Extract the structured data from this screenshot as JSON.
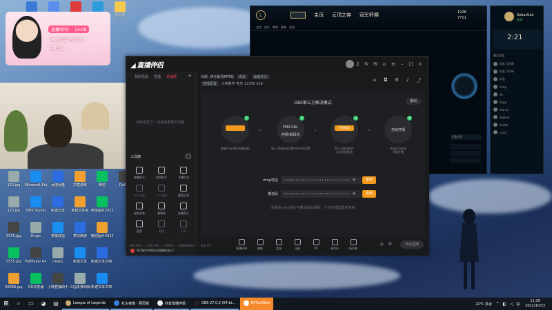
{
  "desktop": {
    "icons_top": [
      {
        "label": "Debut Video"
      },
      {
        "label": "iPhone Backup"
      },
      {
        "label": "网易云音乐"
      },
      {
        "label": "腾讯视频"
      },
      {
        "label": "宝可梦"
      }
    ],
    "icons_grid": [
      {
        "label": "123.jpg"
      },
      {
        "label": "Microsoft Edge"
      },
      {
        "label": "百度网盘"
      },
      {
        "label": "护盾游戏"
      },
      {
        "label": "微信"
      },
      {
        "label": "Dolby"
      },
      {
        "label": "123.jpg"
      },
      {
        "label": "OBS Studio"
      },
      {
        "label": "新建文本"
      },
      {
        "label": "新建文件夹"
      },
      {
        "label": "微信图片20220..."
      },
      {
        "label": "5555.jpg"
      },
      {
        "label": "Origin"
      },
      {
        "label": "英雄联盟"
      },
      {
        "label": "梦幻西游"
      },
      {
        "label": "微信图片20220..."
      },
      {
        "label": "5555.jpg"
      },
      {
        "label": "PotPlayer 64 bit"
      },
      {
        "label": "DeepL"
      },
      {
        "label": "新建文本"
      },
      {
        "label": "新建文本文档 (2).txt"
      },
      {
        "label": "66666.jpg"
      },
      {
        "label": "QQ浏览器"
      },
      {
        "label": "小熊直播助手"
      },
      {
        "label": "三国杀移动版"
      },
      {
        "label": "新建文本文档.txt"
      }
    ]
  },
  "avatar_widget": {
    "timer_label": "直播时间：",
    "timer_value": "14:08",
    "line1": "海螺宝宝专属儿",
    "line2": "电模儿"
  },
  "lol": {
    "logo": "L",
    "nav": [
      "主页",
      "云顶之弈",
      "冠军杯赛"
    ],
    "subtabs": [
      "总览",
      "排位",
      "商城",
      "赛事",
      "资源"
    ],
    "bottom_label": "匹配 (6)",
    "friends": {
      "clock": "2:21",
      "name": "Sebastian",
      "status": "在线",
      "gold1": "1228",
      "gold2": "7711",
      "items": [
        "好友 (5/38)",
        "好友 (5/38)",
        "好友",
        "Vimp",
        "Sn",
        "Bopy",
        "Vienna",
        "Skyline",
        "Snake",
        "Luna"
      ],
      "sec_label": "最近游戏"
    }
  },
  "app": {
    "brand": "直播伴侣",
    "left_tabs": [
      "我的场景",
      "直播",
      "开黑局"
    ],
    "left_empty": "OBS模式下，功能设置暂不可用",
    "tools_title": "工具箱",
    "tools": [
      {
        "label": "弹幕助手"
      },
      {
        "label": "房管助手"
      },
      {
        "label": "主播任务"
      },
      {
        "label": "电子礼盒"
      },
      {
        "label": "个人装扮"
      },
      {
        "label": "截图工具"
      },
      {
        "label": "虚拟形象"
      },
      {
        "label": "弹幕姬"
      },
      {
        "label": "直播音乐"
      },
      {
        "label": "更多"
      },
      {
        "label": "数据"
      },
      {
        "label": "分享"
      }
    ],
    "info_line1_prefix": "标题:",
    "info_title": "峡谷最强鸭鸭站",
    "info_tag1": "修改",
    "info_tag2": "画面标记",
    "info_line2_tag": "直播配置",
    "info_category": "大神教学",
    "info_stat1": "电竞",
    "info_stat2": "12306",
    "info_stat3": "936",
    "obs": {
      "title": "OBS第三方推流模式",
      "exit": "退出",
      "steps": [
        {
          "num": "1",
          "center": "",
          "desc1": "复制rtmp地址和推流码",
          "desc2": ""
        },
        {
          "num": "2",
          "center": "FMS URL",
          "center2": "密钥/串码流",
          "desc1": "填入OBS推流设置中的对应位置",
          "desc2": ""
        },
        {
          "num": "3",
          "center": "开始推流",
          "desc1": "第三方推流软件",
          "desc2": "点击开始推流"
        },
        {
          "num": "4",
          "center": "自动开播",
          "desc1": "开启后可自动",
          "desc2": "开始开播"
        }
      ],
      "fields": [
        {
          "label": "rtmp地址",
          "value": "••••••••••••••••••••••••••••",
          "btn": "复制"
        },
        {
          "label": "推流码",
          "value": "••••••••••••••••••••••••••••",
          "btn": "复制"
        }
      ],
      "note": "关播后rtmp地址与推流码会刷新，下次开播需重新复制"
    },
    "bottom_items": [
      "直播间装",
      "美颜",
      "音效",
      "连麦",
      "PK",
      "麦克风",
      "扬声器"
    ],
    "start_btn": "开始直播",
    "status_warn": "您可能不符合后台直播标准么?",
    "stats": [
      "CPU 3%",
      "内存 5%",
      "FPS 0",
      "码率 0kb/s",
      "丢帧 0%"
    ]
  },
  "taskbar": {
    "start": "⊞",
    "tasks": [
      {
        "label": "League of Legends",
        "color": "#c8aa6e"
      },
      {
        "label": "红尘夜客 · 网页版",
        "color": "#3c7de0"
      },
      {
        "label": "抖音直播伴侣",
        "color": "#f0f0f0"
      },
      {
        "label": "OBS 27.0.2 (64 bi...",
        "color": "#222222"
      },
      {
        "label": "DYToolWeb",
        "color": "#ffffff"
      }
    ],
    "weather": "21°C 多云",
    "time": "11:20",
    "date": "2022/10/23"
  }
}
